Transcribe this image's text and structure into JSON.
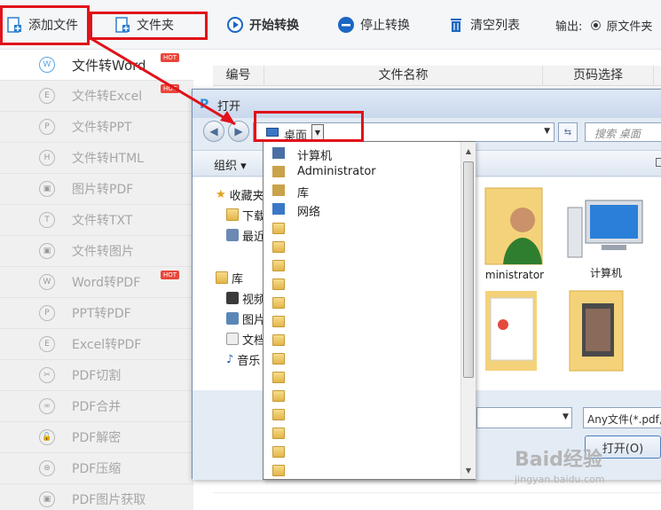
{
  "toolbar": {
    "add_file": "添加文件",
    "folder": "文件夹",
    "start": "开始转换",
    "stop": "停止转换",
    "clear": "清空列表",
    "output_label": "输出:",
    "output_option": "原文件夹"
  },
  "sidebar": {
    "hot_label": "HOT",
    "items": [
      {
        "label": "文件转Word",
        "icon": "W",
        "hot": true,
        "active": true
      },
      {
        "label": "文件转Excel",
        "icon": "E",
        "hot": true
      },
      {
        "label": "文件转PPT",
        "icon": "P"
      },
      {
        "label": "文件转HTML",
        "icon": "H"
      },
      {
        "label": "图片转PDF",
        "icon": "▣"
      },
      {
        "label": "文件转TXT",
        "icon": "T"
      },
      {
        "label": "文件转图片",
        "icon": "▣"
      },
      {
        "label": "Word转PDF",
        "icon": "W",
        "hot": true
      },
      {
        "label": "PPT转PDF",
        "icon": "P"
      },
      {
        "label": "Excel转PDF",
        "icon": "E"
      },
      {
        "label": "PDF切割",
        "icon": "✂"
      },
      {
        "label": "PDF合并",
        "icon": "∞"
      },
      {
        "label": "PDF解密",
        "icon": "🔓"
      },
      {
        "label": "PDF压缩",
        "icon": "⊛"
      },
      {
        "label": "PDF图片获取",
        "icon": "▣"
      }
    ]
  },
  "table": {
    "columns": [
      "编号",
      "文件名称",
      "页码选择"
    ]
  },
  "dialog": {
    "title": "打开",
    "location": "桌面",
    "search_placeholder": "搜索 桌面",
    "organize": "组织 ▾",
    "nav": {
      "favorites": "收藏夹",
      "downloads": "下载",
      "recent": "最近",
      "library": "库",
      "videos": "视频",
      "pictures": "图片",
      "documents": "文档",
      "music": "音乐"
    },
    "tiles": {
      "admin": "ministrator",
      "computer": "计算机"
    },
    "file_type": "Any文件(*.pdf,*.",
    "open_button": "打开(O)",
    "dropdown": {
      "items": [
        "计算机",
        "Administrator",
        "库",
        "网络"
      ]
    }
  },
  "watermark": {
    "text": "Baid经验",
    "sub": "jingyan.baidu.com"
  },
  "colors": {
    "highlight_red": "#e1121a",
    "accent_blue": "#58a7e6"
  }
}
